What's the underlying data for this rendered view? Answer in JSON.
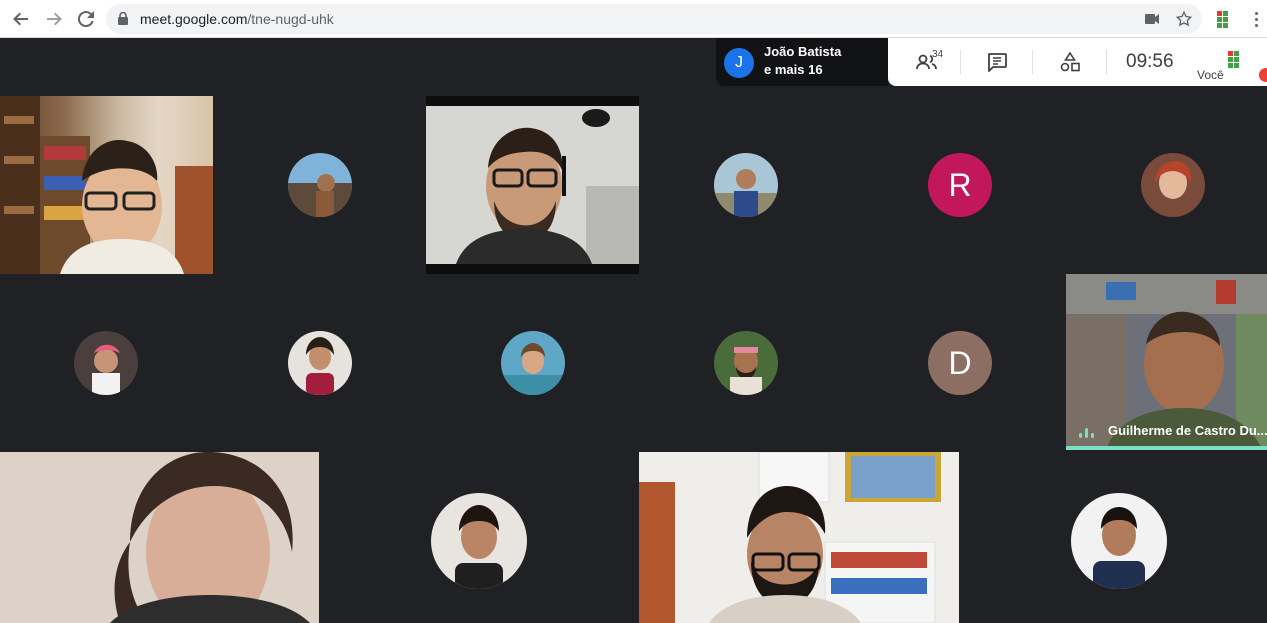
{
  "browser": {
    "url_host": "meet.google.com",
    "url_path": "/tne-nugd-uhk",
    "icons": [
      "back-arrow-icon",
      "forward-arrow-icon",
      "reload-icon",
      "lock-icon",
      "camera-icon",
      "star-icon",
      "extension-icon",
      "menu-icon"
    ]
  },
  "meeting": {
    "presenter_initial": "J",
    "presenter_name": "João Batista",
    "presenter_more": "e mais 16",
    "participant_count": "34",
    "clock": "09:56",
    "self_label": "Você"
  },
  "tiles": {
    "letter_r": "R",
    "letter_d": "D",
    "speaker_name": "Guilherme de Castro Du..."
  },
  "colors": {
    "background": "#202124",
    "presenter_avatar": "#1a73e8",
    "avatar_r": "#c2185b",
    "avatar_d": "#8d6e63",
    "speaking_accent": "#7adec8"
  }
}
